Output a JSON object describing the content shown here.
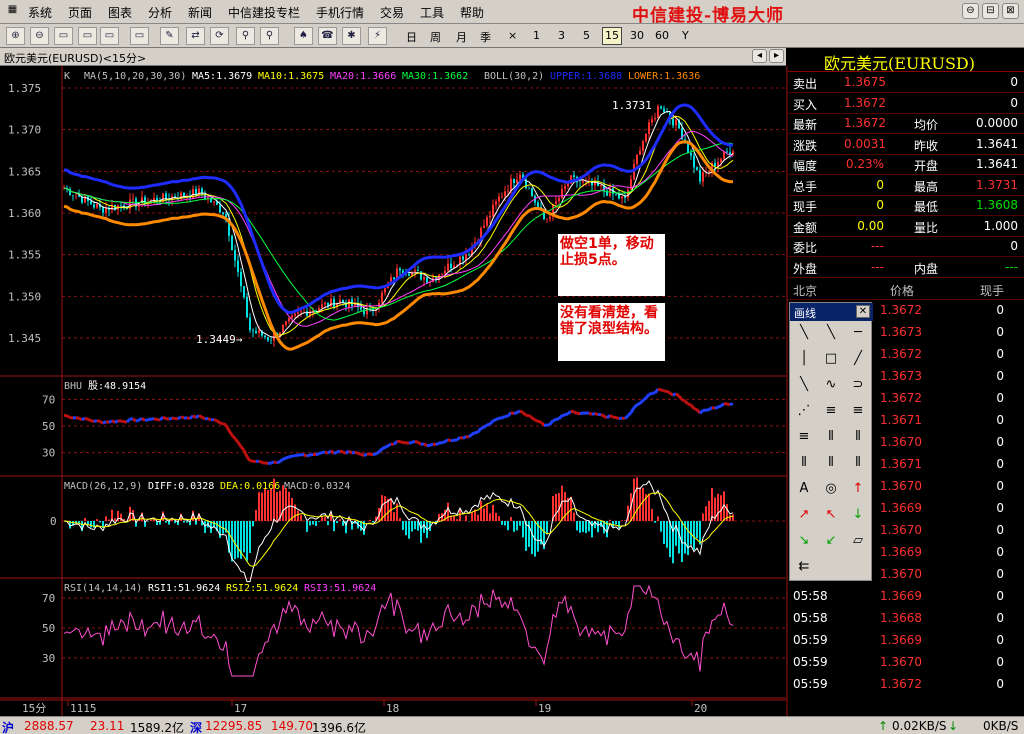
{
  "menu": [
    "系统",
    "页面",
    "图表",
    "分析",
    "新闻",
    "中信建投专栏",
    "手机行情",
    "交易",
    "工具",
    "帮助"
  ],
  "brand": "中信建投-博易大师",
  "window_buttons": [
    "⊖",
    "⊟",
    "⊠"
  ],
  "periods": {
    "day": "日",
    "week": "周",
    "month": "月",
    "season": "季",
    "times": "×",
    "p1": "1",
    "p3": "3",
    "p5": "5",
    "p15": "15",
    "p30": "30",
    "p60": "60",
    "year": "Y"
  },
  "chart": {
    "title": "欧元美元(EURUSD)<15分>",
    "ma_legend": {
      "k": "K",
      "ma": "MA(5,10,20,30,30)",
      "ma5": "MA5:1.3679",
      "ma10": "MA10:1.3675",
      "ma20": "MA20:1.3666",
      "ma30": "MA30:1.3662",
      "boll": "BOLL(30,2)",
      "upper": "UPPER:1.3688",
      "lower": "LOWER:1.3636"
    },
    "yticks": [
      "1.375",
      "1.370",
      "1.365",
      "1.360",
      "1.355",
      "1.350",
      "1.345"
    ],
    "hi_label": "1.3731",
    "lo_label": "1.3449→",
    "bhu": {
      "label": "BHU",
      "value": "股:48.9154",
      "ticks": [
        "70",
        "50",
        "30"
      ]
    },
    "macd": {
      "label": "MACD(26,12,9)",
      "diff": "DIFF:0.0328",
      "dea": "DEA:0.0166",
      "macd": "MACD:0.0324",
      "tick": "0"
    },
    "rsi": {
      "label": "RSI(14,14,14)",
      "rsi1": "RSI1:51.9624",
      "rsi2": "RSI2:51.9624",
      "rsi3": "RSI3:51.9624",
      "ticks": [
        "70",
        "50",
        "30"
      ]
    },
    "period_label": "15分",
    "xlabels": [
      "1115",
      "17",
      "18",
      "19",
      "20"
    ]
  },
  "annotations": {
    "note1": "做空1单，移动止损5点。",
    "note2": "没有看清楚，看错了浪型结构。"
  },
  "quote": {
    "title": "欧元美元(EURUSD)",
    "rows": [
      {
        "l": "卖出",
        "v": "1.3675",
        "v2": "0"
      },
      {
        "l": "买入",
        "v": "1.3672",
        "v2": "0"
      },
      {
        "l": "最新",
        "v": "1.3672",
        "l2": "均价",
        "v2": "0.0000"
      },
      {
        "l": "涨跌",
        "v": "0.0031",
        "l2": "昨收",
        "v2": "1.3641"
      },
      {
        "l": "幅度",
        "v": "0.23%",
        "l2": "开盘",
        "v2": "1.3641"
      },
      {
        "l": "总手",
        "v": "0",
        "l2": "最高",
        "v2": "1.3731"
      },
      {
        "l": "现手",
        "v": "0",
        "l2": "最低",
        "v2": "1.3608"
      },
      {
        "l": "金额",
        "v": "0.00",
        "l2": "量比",
        "v2": "1.000"
      },
      {
        "l": "委比",
        "v": "---",
        "v2": "0"
      },
      {
        "l": "外盘",
        "v": "---",
        "l2": "内盘",
        "v2": "---"
      }
    ],
    "tick_header": {
      "c1": "北京",
      "c2": "价格",
      "c3": "现手"
    },
    "ticks": [
      {
        "t": "",
        "p": "1.3672",
        "q": "0"
      },
      {
        "t": "",
        "p": "1.3673",
        "q": "0"
      },
      {
        "t": "",
        "p": "1.3672",
        "q": "0"
      },
      {
        "t": "",
        "p": "1.3673",
        "q": "0"
      },
      {
        "t": "",
        "p": "1.3672",
        "q": "0"
      },
      {
        "t": "",
        "p": "1.3671",
        "q": "0"
      },
      {
        "t": "",
        "p": "1.3670",
        "q": "0"
      },
      {
        "t": "",
        "p": "1.3671",
        "q": "0"
      },
      {
        "t": "",
        "p": "1.3670",
        "q": "0"
      },
      {
        "t": "",
        "p": "1.3669",
        "q": "0"
      },
      {
        "t": "",
        "p": "1.3670",
        "q": "0"
      },
      {
        "t": "",
        "p": "1.3669",
        "q": "0"
      },
      {
        "t": "",
        "p": "1.3670",
        "q": "0"
      },
      {
        "t": "05:58",
        "p": "1.3669",
        "q": "0"
      },
      {
        "t": "05:58",
        "p": "1.3668",
        "q": "0"
      },
      {
        "t": "05:59",
        "p": "1.3669",
        "q": "0"
      },
      {
        "t": "05:59",
        "p": "1.3670",
        "q": "0"
      },
      {
        "t": "05:59",
        "p": "1.3672",
        "q": "0"
      }
    ]
  },
  "tools": {
    "title": "画线",
    "glyphs": [
      "╲",
      "╲",
      "─",
      "│",
      "□",
      "╱",
      "╲",
      "∿",
      "⊃",
      "⋰",
      "≡",
      "≡",
      "≡",
      "⦀",
      "⦀",
      "⦀",
      "⦀",
      "⦀",
      "A",
      "◎",
      "↑",
      "↗",
      "↖",
      "↓",
      "↘",
      "↙",
      "▱",
      "⇇"
    ]
  },
  "status": {
    "sh": "沪",
    "sh_idx": "2888.57",
    "sh_chg": "23.11",
    "sh_amt": "1589.2亿",
    "sz": "深",
    "sz_idx": "12295.85",
    "sz_chg": "149.70",
    "sz_amt": "1396.6亿",
    "net1": "0.02KB/S",
    "net2": "0KB/S"
  },
  "colors": {
    "up": "#ff3030",
    "down": "#00e0e0",
    "grid": "#8a1010",
    "upper": "#1e2cff",
    "lower": "#ff8a00",
    "ma5": "#ffffff",
    "ma10": "#ffff00",
    "ma20": "#ff40ff",
    "ma30": "#00ff40",
    "rsi": "#ff50d0"
  }
}
